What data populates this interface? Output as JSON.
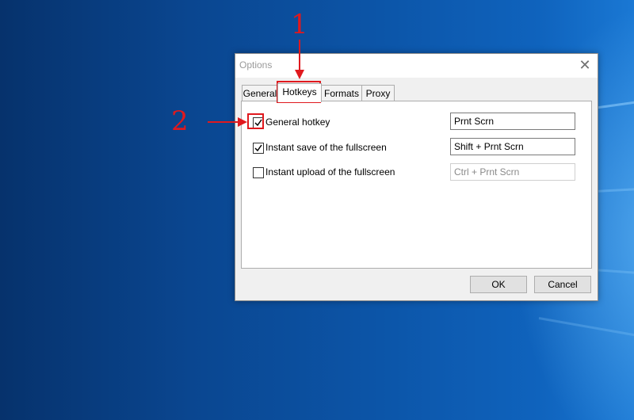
{
  "dialog": {
    "title": "Options",
    "close_icon": "close-icon"
  },
  "tabs": [
    {
      "label": "General",
      "active": false
    },
    {
      "label": "Hotkeys",
      "active": true
    },
    {
      "label": "Formats",
      "active": false
    },
    {
      "label": "Proxy",
      "active": false
    }
  ],
  "hotkeys": [
    {
      "label": "General hotkey",
      "checked": true,
      "value": "Prnt Scrn",
      "enabled": true
    },
    {
      "label": "Instant save of the fullscreen",
      "checked": true,
      "value": "Shift + Prnt Scrn",
      "enabled": true
    },
    {
      "label": "Instant upload of the fullscreen",
      "checked": false,
      "value": "Ctrl + Prnt Scrn",
      "enabled": false
    }
  ],
  "buttons": {
    "ok": "OK",
    "cancel": "Cancel"
  },
  "annotations": {
    "step1": "1",
    "step2": "2",
    "color": "#e0191e"
  }
}
